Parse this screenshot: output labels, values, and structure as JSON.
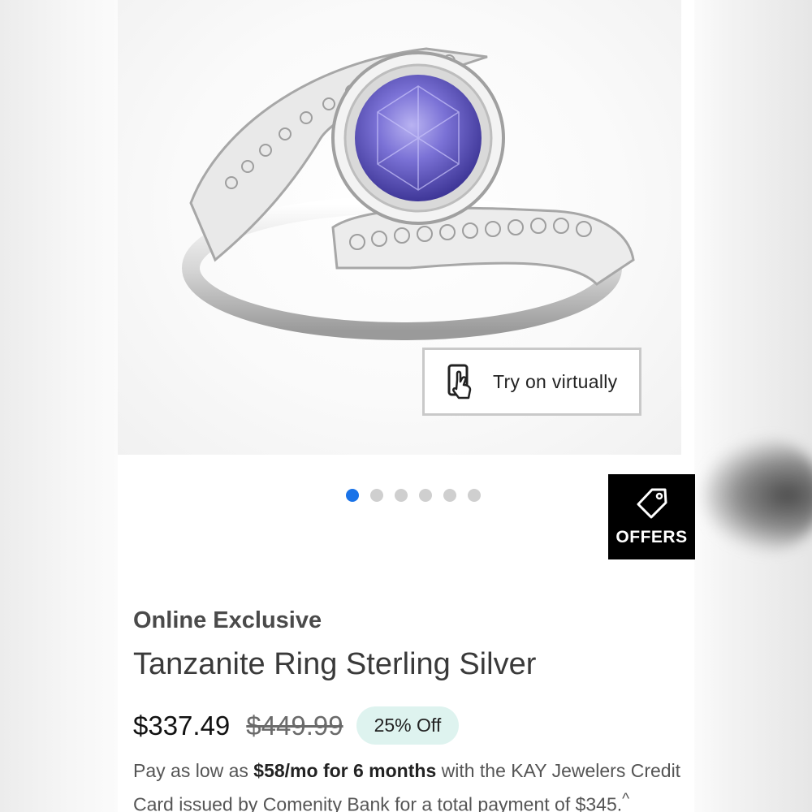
{
  "product": {
    "eyebrow": "Online Exclusive",
    "title": "Tanzanite Ring Sterling Silver",
    "price": "$337.49",
    "original_price": "$449.99",
    "discount_badge": "25% Off"
  },
  "gallery": {
    "image_alt": "Tanzanite ring in sterling silver",
    "try_on_label": "Try on virtually",
    "dot_count": 6,
    "active_dot": 1
  },
  "offers": {
    "label": "OFFERS"
  },
  "financing": {
    "prefix": "Pay as low as ",
    "bold": "$58/mo for 6 months",
    "suffix": " with the KAY Jewelers Credit Card issued by Comenity Bank for a total payment of $345.",
    "marker": "^"
  },
  "colors": {
    "accent_dot": "#1a73e8",
    "badge_bg": "#def3ef",
    "offers_bg": "#000000",
    "gem": "#6a62c8"
  },
  "icons": {
    "try_on": "hand-phone-icon",
    "offers": "tag-icon"
  }
}
